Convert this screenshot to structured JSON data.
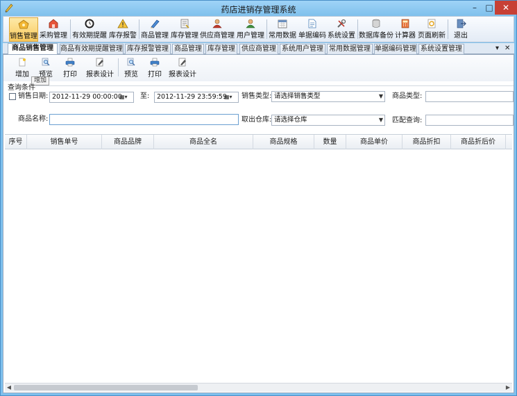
{
  "window": {
    "title": "药店进销存管理系统",
    "min": "–",
    "max": "□",
    "close": "✕"
  },
  "main_toolbar": [
    {
      "label": "销售管理",
      "icon": "sales-icon",
      "active": true
    },
    {
      "label": "采购管理",
      "icon": "purchase-icon"
    },
    {
      "label": "有效期提醒",
      "icon": "clock-icon"
    },
    {
      "label": "库存报警",
      "icon": "warning-icon"
    },
    {
      "label": "商品管理",
      "icon": "pencil-icon"
    },
    {
      "label": "库存管理",
      "icon": "inventory-icon"
    },
    {
      "label": "供应商管理",
      "icon": "supplier-icon"
    },
    {
      "label": "用户管理",
      "icon": "user-icon"
    },
    {
      "label": "常用数据",
      "icon": "calendar-icon"
    },
    {
      "label": "单据编码",
      "icon": "document-icon"
    },
    {
      "label": "系统设置",
      "icon": "tools-icon"
    },
    {
      "label": "数据库备份",
      "icon": "database-icon"
    },
    {
      "label": "计算器",
      "icon": "calculator-icon"
    },
    {
      "label": "页面刷新",
      "icon": "refresh-icon"
    },
    {
      "label": "退出",
      "icon": "exit-icon"
    }
  ],
  "tabs": [
    "商品销售管理",
    "商品有效期提醒管理",
    "库存报警管理",
    "商品管理",
    "库存管理",
    "供应商管理",
    "系统用户管理",
    "常用数据管理",
    "单据编码管理",
    "系统设置管理"
  ],
  "tab_controls": {
    "dropdown": "▾",
    "close": "✕"
  },
  "sub_toolbar": {
    "add": "增加",
    "preview": "预览",
    "print": "打印",
    "report_design": "报表设计",
    "preview2": "预览",
    "print2": "打印",
    "report_design2": "报表设计",
    "tooltip": "增加"
  },
  "query": {
    "group_title": "查询条件",
    "sales_date_label": "销售日期:",
    "date_from": "2012-11-29 00:00:00",
    "to_label": "至:",
    "date_to": "2012-11-29 23:59:59",
    "sales_type_label": "销售类型:",
    "sales_type_value": "请选择销售类型",
    "product_type_label": "商品类型:",
    "product_type_value": "",
    "product_name_label": "商品名称:",
    "product_name_value": "",
    "warehouse_label": "取出仓库:",
    "warehouse_value": "请选择仓库",
    "match_query_label": "匹配查询:",
    "match_query_value": ""
  },
  "grid": {
    "columns": [
      "序号",
      "销售单号",
      "商品品牌",
      "商品全名",
      "商品规格",
      "数量",
      "商品单价",
      "商品折扣",
      "商品折后价"
    ]
  },
  "scrollbar": {
    "left": "◀",
    "right": "▶"
  },
  "colors": {
    "title_bar": "#8fcaf2",
    "active_tool": "#f9c95a",
    "close_button": "#c74035"
  }
}
